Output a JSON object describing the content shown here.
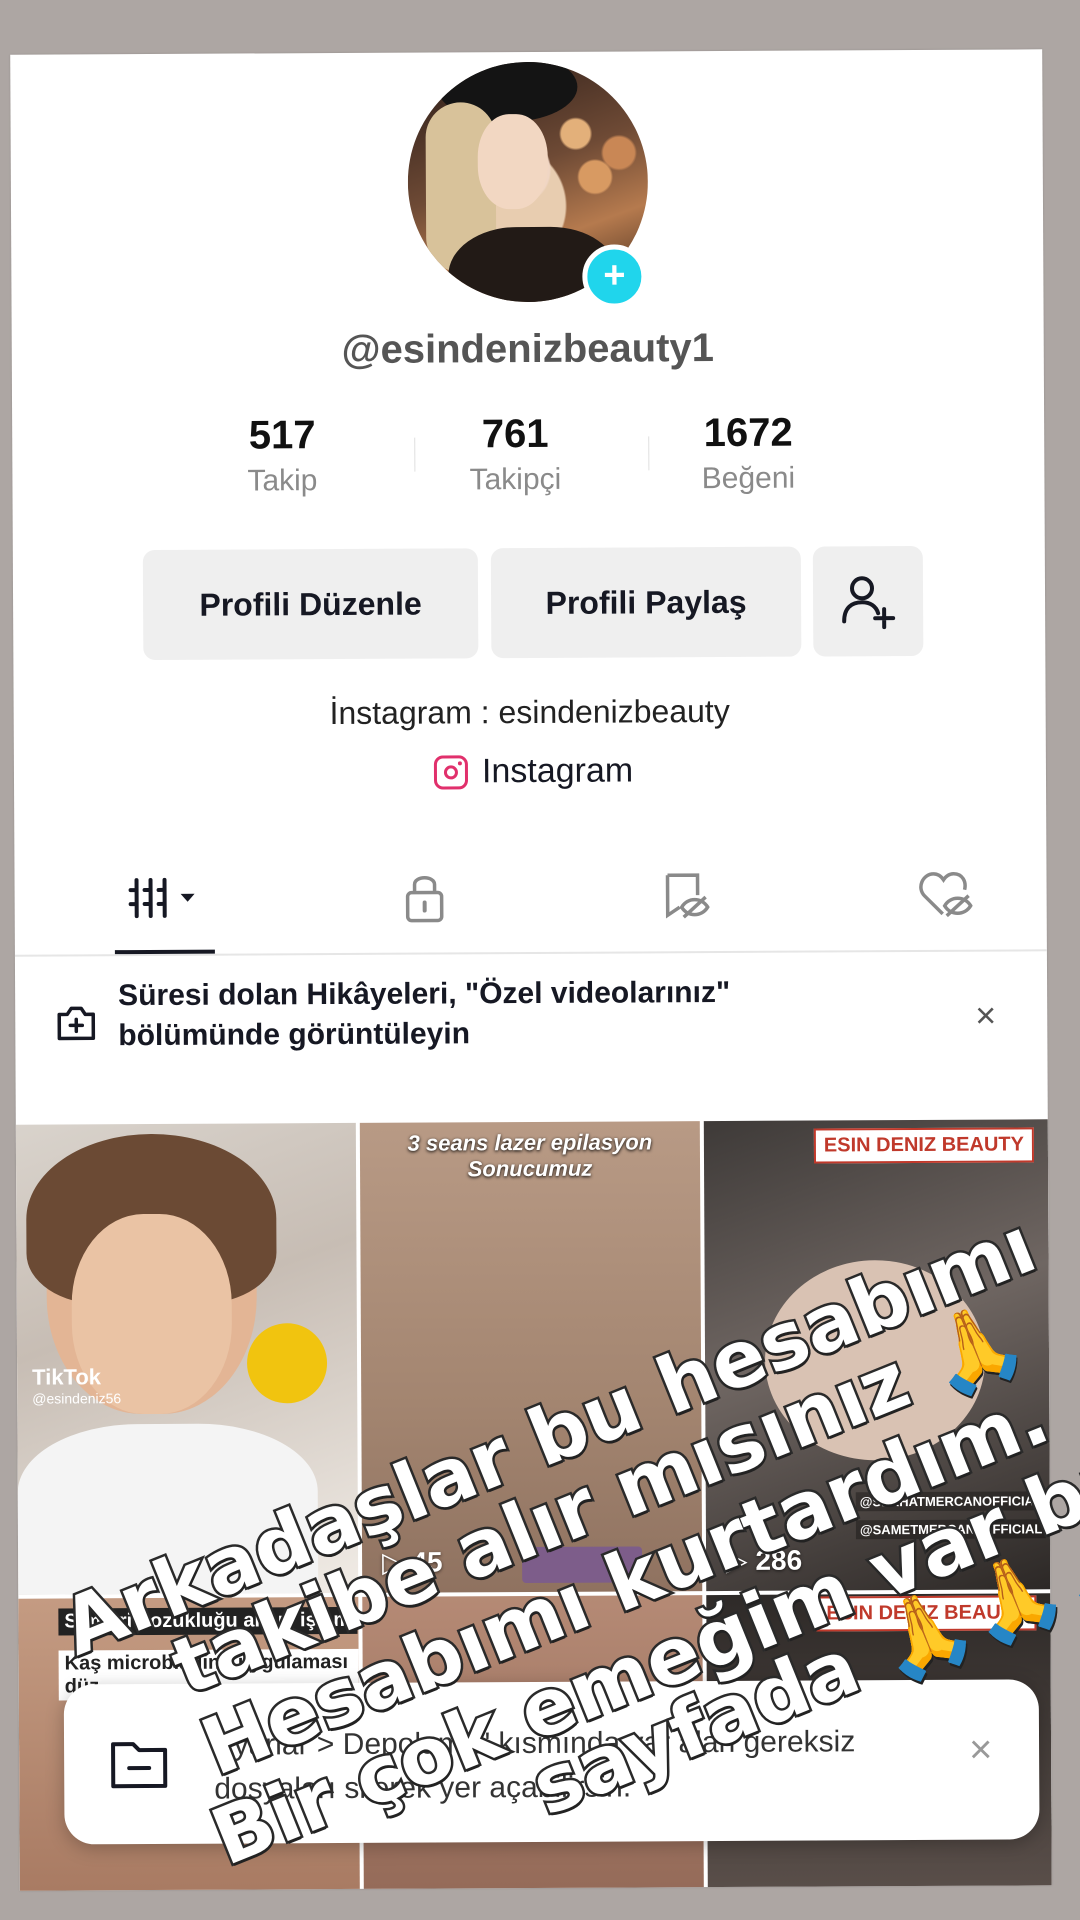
{
  "profile": {
    "username": "@esindenizbeauty1",
    "stats": [
      {
        "value": "517",
        "label": "Takip"
      },
      {
        "value": "761",
        "label": "Takipçi"
      },
      {
        "value": "1672",
        "label": "Beğeni"
      }
    ],
    "edit_label": "Profili Düzenle",
    "share_label": "Profili Paylaş",
    "bio": "İnstagram : esindenizbeauty",
    "link_label": "Instagram"
  },
  "tabs": [
    "videos-grid-icon",
    "lock-icon",
    "saved-icon",
    "liked-icon"
  ],
  "notice": {
    "text": "Süresi dolan Hikâyeleri, \"Özel videolarınız\" bölümünde görüntüleyin",
    "close": "×"
  },
  "grid": {
    "cells": [
      {
        "views": "",
        "caption": ""
      },
      {
        "views": "45",
        "caption": "3 seans lazer epilasyon Sonucumuz"
      },
      {
        "views": "286",
        "caption": "ESIN DENIZ BEAUTY"
      },
      {
        "views": "",
        "caption": "Simetri bozukluğu almış işlem"
      },
      {
        "views": "",
        "caption": "Kaş microblading uygulaması düz"
      },
      {
        "views": "",
        "caption": "ESIN DENIZ BEAUTY"
      }
    ],
    "tags": [
      "@SERHATMERCANOFFICIALL",
      "@SAMETMERCAN_OFFICIAL"
    ],
    "watermark": "TikTok",
    "watermark_user": "@esindeniz56"
  },
  "toast": {
    "text": "Ayarlar > Depolama\" kısmında var alan gereksiz dosyaları silerek yer açabilirsin.",
    "close": "×"
  },
  "overlay_text": {
    "line1": "Arkadaşlar bu hesabımı",
    "line2": "takibe alır mısınız 🙏",
    "line3": "Hesabımı kurtardım.",
    "line4": "Bir çok emeğim var bu",
    "line5": "sayfada 🙏🙏🙏"
  },
  "colors": {
    "accent": "#20d5ec",
    "instagram": "#e1306c",
    "text": "#161823",
    "background": "#ada6a3"
  }
}
